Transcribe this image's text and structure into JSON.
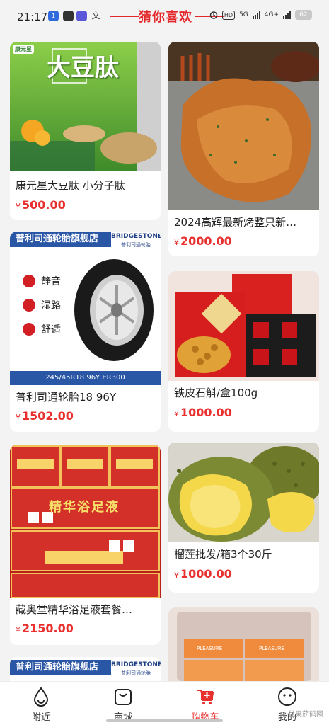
{
  "status_bar": {
    "time": "21:17",
    "app_badge": "1",
    "translate_glyph": "文",
    "network_label": "5G",
    "network2_label": "4G+",
    "hd_label": "HD",
    "battery": "62"
  },
  "section": {
    "title": "猜你喜欢"
  },
  "products": [
    {
      "title": "康元星大豆肽 小分子肽",
      "currency": "¥",
      "price": "500.00",
      "image_text": "大豆肽",
      "image_brand": "康元星"
    },
    {
      "title": "2024高辉最新烤整只新…",
      "currency": "¥",
      "price": "2000.00"
    },
    {
      "title": "普利司通轮胎18 96Y",
      "currency": "¥",
      "price": "1502.00",
      "store_banner": "普利司通轮胎旗舰店",
      "brand_logo": "BRIDGESTONE",
      "brand_sub": "普利司通轮胎",
      "features": [
        "静音",
        "湿路",
        "舒适"
      ],
      "spec": "245/45R18 96Y ER300"
    },
    {
      "title": "铁皮石斛/盒100g",
      "currency": "¥",
      "price": "1000.00"
    },
    {
      "title": "藏奥堂精华浴足液套餐…",
      "currency": "¥",
      "price": "2150.00",
      "image_text": "精华浴足液"
    },
    {
      "title": "榴莲批发/箱3个30斤",
      "currency": "¥",
      "price": "1000.00"
    }
  ],
  "partial_cards": {
    "left_banner": "普利司通轮胎旗舰店",
    "left_brand": "BRIDGESTONE",
    "left_brand_sub": "普利司通轮胎",
    "right_box_text": "PLEASURE"
  },
  "tabbar": {
    "tabs": [
      {
        "label": "附近",
        "icon": "location-drop-icon"
      },
      {
        "label": "商城",
        "icon": "shopping-bag-icon"
      },
      {
        "label": "购物车",
        "icon": "cart-icon"
      },
      {
        "label": "我的",
        "icon": "smiley-face-icon"
      }
    ],
    "active_index": 2,
    "active_color": "#e8312f"
  },
  "watermark": "Mi伐果药码网"
}
